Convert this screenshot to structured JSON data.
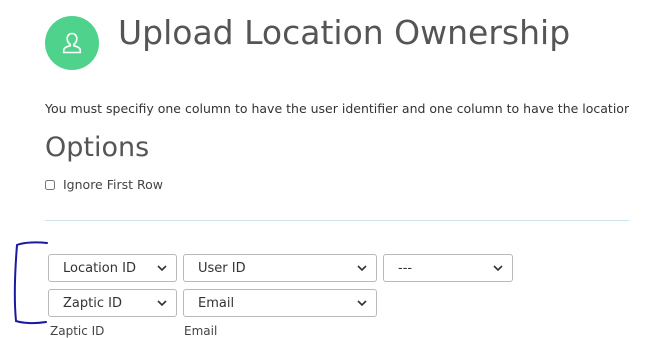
{
  "header": {
    "title": "Upload Location Ownership",
    "avatar_icon": "user-icon",
    "avatar_color": "#4fd28b"
  },
  "instructions": "You must specifiy one column to have the user identifier and one column to have the location identifier",
  "options": {
    "title": "Options",
    "ignore_first_row": {
      "label": "Ignore First Row",
      "checked": false
    }
  },
  "mappings": {
    "row1": [
      "Location ID",
      "User ID",
      "---"
    ],
    "row2": [
      "Zaptic ID",
      "Email"
    ]
  },
  "columns": [
    "Zaptic ID",
    "Email"
  ],
  "annotation_color": "#1a1aa0"
}
